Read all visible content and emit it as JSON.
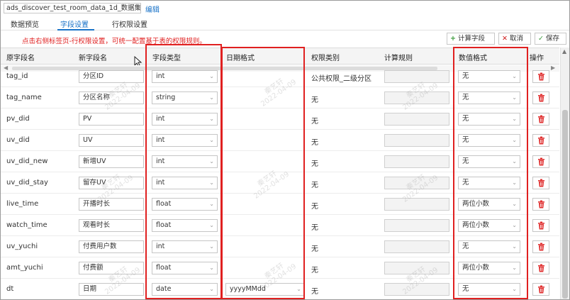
{
  "header": {
    "dataset_name": "ads_discover_test_room_data_1d_数据集",
    "edit_label": "编辑"
  },
  "tabs": [
    {
      "label": "数据预览",
      "active": false
    },
    {
      "label": "字段设置",
      "active": true
    },
    {
      "label": "行权限设置",
      "active": false
    }
  ],
  "notice": "点击右侧标签页-行权限设置，可统一配置基于表的权限规则。",
  "toolbar": {
    "calc_field_label": "计算字段",
    "cancel_label": "取消",
    "save_label": "保存"
  },
  "columns": {
    "orig_name": "原字段名",
    "new_name": "新字段名",
    "field_type": "字段类型",
    "date_format": "日期格式",
    "permission": "权限类别",
    "calc_rule": "计算规则",
    "number_format": "数值格式",
    "action": "操作"
  },
  "rows": [
    {
      "orig": "tag_id",
      "new": "分区ID",
      "type": "int",
      "date_format": "",
      "permission": "公共权限_二级分区",
      "number_format": "无"
    },
    {
      "orig": "tag_name",
      "new": "分区名称",
      "type": "string",
      "date_format": "",
      "permission": "无",
      "number_format": "无"
    },
    {
      "orig": "pv_did",
      "new": "PV",
      "type": "int",
      "date_format": "",
      "permission": "无",
      "number_format": "无"
    },
    {
      "orig": "uv_did",
      "new": "UV",
      "type": "int",
      "date_format": "",
      "permission": "无",
      "number_format": "无"
    },
    {
      "orig": "uv_did_new",
      "new": "新增UV",
      "type": "int",
      "date_format": "",
      "permission": "无",
      "number_format": "无"
    },
    {
      "orig": "uv_did_stay",
      "new": "留存UV",
      "type": "int",
      "date_format": "",
      "permission": "无",
      "number_format": "无"
    },
    {
      "orig": "live_time",
      "new": "开播时长",
      "type": "float",
      "date_format": "",
      "permission": "无",
      "number_format": "两位小数"
    },
    {
      "orig": "watch_time",
      "new": "观看时长",
      "type": "float",
      "date_format": "",
      "permission": "无",
      "number_format": "两位小数"
    },
    {
      "orig": "uv_yuchi",
      "new": "付费用户数",
      "type": "int",
      "date_format": "",
      "permission": "无",
      "number_format": "无"
    },
    {
      "orig": "amt_yuchi",
      "new": "付费额",
      "type": "float",
      "date_format": "",
      "permission": "无",
      "number_format": "两位小数"
    },
    {
      "orig": "dt",
      "new": "日期",
      "type": "date",
      "date_format": "yyyyMMdd",
      "permission": "无",
      "number_format": "无"
    }
  ],
  "watermark": {
    "name": "秦艺轩",
    "date": "2022-04-09"
  },
  "colors": {
    "accent": "#1a73c8",
    "highlight_red": "#e02020",
    "delete_red": "#e03030"
  }
}
